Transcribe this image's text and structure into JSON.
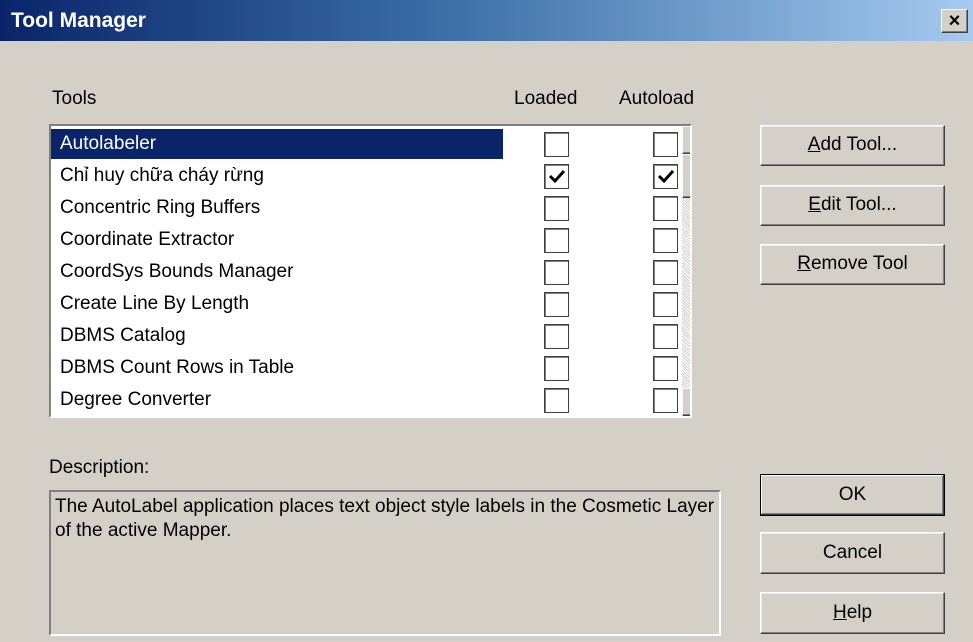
{
  "window": {
    "title": "Tool Manager",
    "close_label": "×"
  },
  "columns": {
    "tools": "Tools",
    "loaded": "Loaded",
    "autoload": "Autoload"
  },
  "tools": [
    {
      "name": "Autolabeler",
      "loaded": false,
      "autoload": false,
      "selected": true
    },
    {
      "name": "Chỉ huy chữa cháy rừng",
      "loaded": true,
      "autoload": true,
      "selected": false
    },
    {
      "name": "Concentric Ring Buffers",
      "loaded": false,
      "autoload": false,
      "selected": false
    },
    {
      "name": "Coordinate Extractor",
      "loaded": false,
      "autoload": false,
      "selected": false
    },
    {
      "name": "CoordSys Bounds Manager",
      "loaded": false,
      "autoload": false,
      "selected": false
    },
    {
      "name": "Create Line By Length",
      "loaded": false,
      "autoload": false,
      "selected": false
    },
    {
      "name": "DBMS Catalog",
      "loaded": false,
      "autoload": false,
      "selected": false
    },
    {
      "name": "DBMS Count Rows in Table",
      "loaded": false,
      "autoload": false,
      "selected": false
    },
    {
      "name": "Degree Converter",
      "loaded": false,
      "autoload": false,
      "selected": false
    }
  ],
  "buttons": {
    "add_tool": {
      "mnemonic": "A",
      "rest": "dd Tool..."
    },
    "edit_tool": {
      "mnemonic": "E",
      "rest": "dit Tool..."
    },
    "remove_tool": {
      "mnemonic": "R",
      "rest": "emove Tool"
    },
    "ok": "OK",
    "cancel": "Cancel",
    "help": {
      "mnemonic": "H",
      "rest": "elp"
    }
  },
  "description": {
    "label": "Description:",
    "text": "The AutoLabel application places text object style labels in the Cosmetic Layer of the active Mapper."
  }
}
